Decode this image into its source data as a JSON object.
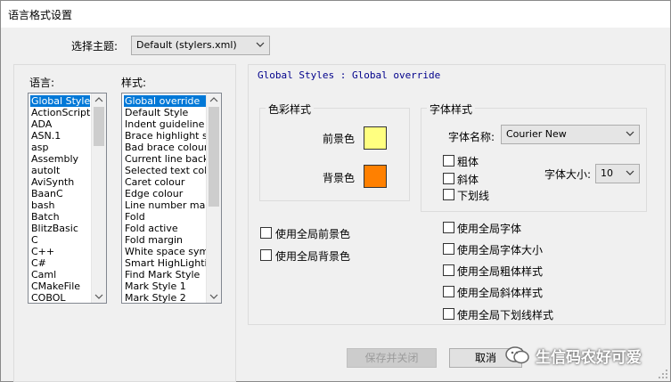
{
  "window": {
    "title": "语言格式设置"
  },
  "theme": {
    "label": "选择主题:",
    "value": "Default (stylers.xml)"
  },
  "language": {
    "label": "语言:",
    "items": [
      "Global Styles",
      "ActionScript",
      "ADA",
      "ASN.1",
      "asp",
      "Assembly",
      "autoIt",
      "AviSynth",
      "BaanC",
      "bash",
      "Batch",
      "BlitzBasic",
      "C",
      "C++",
      "C#",
      "Caml",
      "CMakeFile",
      "COBOL"
    ],
    "selected": "Global Styles"
  },
  "style": {
    "label": "样式:",
    "items": [
      "Global override",
      "Default Style",
      "Indent guideline sty",
      "Brace highlight style",
      "Bad brace colour",
      "Current line backgr",
      "Selected text colou",
      "Caret colour",
      "Edge colour",
      "Line number margin",
      "Fold",
      "Fold active",
      "Fold margin",
      "White space symbo",
      "Smart HighLighting",
      "Find Mark Style",
      "Mark Style 1",
      "Mark Style 2"
    ],
    "selected": "Global override"
  },
  "panel_title": "Global Styles : Global override",
  "color_style": {
    "legend": "色彩样式",
    "foreground_label": "前景色",
    "background_label": "背景色",
    "foreground_color": "#ffff80",
    "background_color": "#ff8000"
  },
  "font_style": {
    "legend": "字体样式",
    "font_name_label": "字体名称:",
    "font_name_value": "Courier New",
    "bold_label": "粗体",
    "italic_label": "斜体",
    "underline_label": "下划线",
    "font_size_label": "字体大小:",
    "font_size_value": "10"
  },
  "global_checks_left": [
    "使用全局前景色",
    "使用全局背景色"
  ],
  "global_checks_right": [
    "使用全局字体",
    "使用全局字体大小",
    "使用全局粗体样式",
    "使用全局斜体样式",
    "使用全局下划线样式"
  ],
  "buttons": {
    "save_close": "保存并关闭",
    "cancel": "取消"
  },
  "watermark": {
    "text": "生信码农好可爱"
  },
  "icons": {
    "dropdown": "chevron-down-icon",
    "scroll_up": "arrow-up-icon",
    "scroll_down": "arrow-down-icon",
    "watermark": "wechat-icon"
  },
  "colors": {
    "selection": "#0078d7",
    "panel_title": "#00008b"
  }
}
